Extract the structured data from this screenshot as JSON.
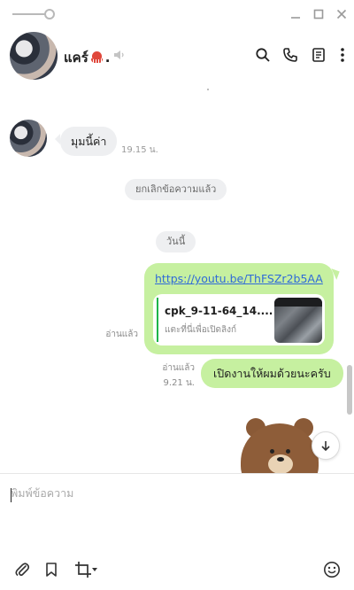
{
  "window": {
    "minimize_icon": "minimize-icon",
    "maximize_icon": "maximize-icon",
    "close_icon": "close-icon"
  },
  "header": {
    "chat_name": "แคร์",
    "name_suffix": ".",
    "icons": [
      "search-icon",
      "phone-icon",
      "notes-icon",
      "more-icon"
    ]
  },
  "messages": {
    "incoming": {
      "text": "มุมนี้ค่า",
      "time": "19.15 น."
    },
    "system_unsent": "ยกเลิกข้อความแล้ว",
    "date_divider": "วันนี้",
    "link_message": {
      "url": "https://youtu.be/ThFSZr2b5AA",
      "preview_title": "cpk_9-11-64_14....",
      "preview_subtitle": "แตะที่นี่เพื่อเปิดลิงก์",
      "read_label": "อ่านแล้ว"
    },
    "text_message": {
      "text": "เปิดงานให้ผมด้วยนะครับ",
      "read_label": "อ่านแล้ว",
      "time": "9.21 น."
    }
  },
  "composer": {
    "placeholder": "พิมพ์ข้อความ",
    "toolbar_icons": [
      "attach-icon",
      "bookmark-icon",
      "crop-icon",
      "emoji-icon"
    ]
  },
  "colors": {
    "outgoing_bubble": "#c6f0a0",
    "incoming_bubble": "#eeeff1",
    "link": "#2f6ad8",
    "accent_bar": "#17b54a"
  }
}
